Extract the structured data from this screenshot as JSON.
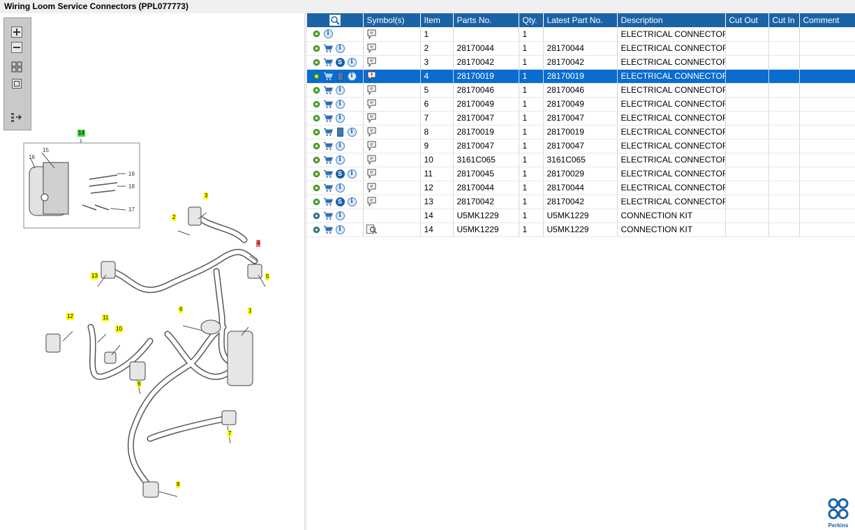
{
  "title": "Wiring Loom Service Connectors (PPL077773)",
  "toolbox": {
    "buttons": [
      {
        "name": "zoom-in-icon"
      },
      {
        "name": "zoom-out-icon"
      },
      {
        "name": "fit-all-icon"
      },
      {
        "name": "fit-window-icon"
      },
      {
        "name": "list-arrow-icon"
      }
    ]
  },
  "diagram": {
    "callouts": [
      {
        "label": "14",
        "color": "#3fd13f"
      },
      {
        "label": "15"
      },
      {
        "label": "16"
      },
      {
        "label": "19"
      },
      {
        "label": "18"
      },
      {
        "label": "17"
      },
      {
        "label": "3",
        "color": "#ffff00"
      },
      {
        "label": "2",
        "color": "#ffff00"
      },
      {
        "label": "4",
        "color": "#ff6b6b"
      },
      {
        "label": "5",
        "color": "#ffff00"
      },
      {
        "label": "13",
        "color": "#ffff00"
      },
      {
        "label": "6",
        "color": "#ffff00"
      },
      {
        "label": "1",
        "color": "#ffff00"
      },
      {
        "label": "12",
        "color": "#ffff00"
      },
      {
        "label": "11",
        "color": "#ffff00"
      },
      {
        "label": "10",
        "color": "#ffff00"
      },
      {
        "label": "9",
        "color": "#ffff00"
      },
      {
        "label": "7",
        "color": "#ffff00"
      },
      {
        "label": "8",
        "color": "#ffff00"
      }
    ]
  },
  "table": {
    "columns": [
      "",
      "Symbol(s)",
      "Item",
      "Parts No.",
      "Qty.",
      "Latest Part No.",
      "Description",
      "Cut Out",
      "Cut In",
      "Comment"
    ],
    "rows": [
      {
        "icons": [
          "gear-icon",
          "info-icon"
        ],
        "symbol": "note",
        "item": "1",
        "part": "",
        "qty": "1",
        "latest": "",
        "desc": "ELECTRICAL CONNECTOR"
      },
      {
        "icons": [
          "gear-icon",
          "cart-icon",
          "info-icon"
        ],
        "symbol": "note",
        "item": "2",
        "part": "28170044",
        "qty": "1",
        "latest": "28170044",
        "desc": "ELECTRICAL CONNECTOR"
      },
      {
        "icons": [
          "gear-icon",
          "cart-icon",
          "s-icon",
          "info-icon"
        ],
        "symbol": "note",
        "item": "3",
        "part": "28170042",
        "qty": "1",
        "latest": "28170042",
        "desc": "ELECTRICAL CONNECTOR"
      },
      {
        "icons": [
          "gear-icon",
          "cart-icon",
          "book-icon",
          "info-icon"
        ],
        "symbol": "note-alert",
        "item": "4",
        "part": "28170019",
        "qty": "1",
        "latest": "28170019",
        "desc": "ELECTRICAL CONNECTOR",
        "selected": true
      },
      {
        "icons": [
          "gear-icon",
          "cart-icon",
          "info-icon"
        ],
        "symbol": "note",
        "item": "5",
        "part": "28170046",
        "qty": "1",
        "latest": "28170046",
        "desc": "ELECTRICAL CONNECTOR"
      },
      {
        "icons": [
          "gear-icon",
          "cart-icon",
          "info-icon"
        ],
        "symbol": "note",
        "item": "6",
        "part": "28170049",
        "qty": "1",
        "latest": "28170049",
        "desc": "ELECTRICAL CONNECTOR"
      },
      {
        "icons": [
          "gear-icon",
          "cart-icon",
          "info-icon"
        ],
        "symbol": "note",
        "item": "7",
        "part": "28170047",
        "qty": "1",
        "latest": "28170047",
        "desc": "ELECTRICAL CONNECTOR"
      },
      {
        "icons": [
          "gear-icon",
          "cart-icon",
          "book-icon",
          "info-icon"
        ],
        "symbol": "note",
        "item": "8",
        "part": "28170019",
        "qty": "1",
        "latest": "28170019",
        "desc": "ELECTRICAL CONNECTOR"
      },
      {
        "icons": [
          "gear-icon",
          "cart-icon",
          "info-icon"
        ],
        "symbol": "note",
        "item": "9",
        "part": "28170047",
        "qty": "1",
        "latest": "28170047",
        "desc": "ELECTRICAL CONNECTOR"
      },
      {
        "icons": [
          "gear-icon",
          "cart-icon",
          "info-icon"
        ],
        "symbol": "note",
        "item": "10",
        "part": "3161C065",
        "qty": "1",
        "latest": "3161C065",
        "desc": "ELECTRICAL CONNECTOR"
      },
      {
        "icons": [
          "gear-icon",
          "cart-icon",
          "s-icon",
          "info-icon"
        ],
        "symbol": "note",
        "item": "11",
        "part": "28170045",
        "qty": "1",
        "latest": "28170029",
        "desc": "ELECTRICAL CONNECTOR"
      },
      {
        "icons": [
          "gear-icon",
          "cart-icon",
          "info-icon"
        ],
        "symbol": "note",
        "item": "12",
        "part": "28170044",
        "qty": "1",
        "latest": "28170044",
        "desc": "ELECTRICAL CONNECTOR"
      },
      {
        "icons": [
          "gear-icon",
          "cart-icon",
          "s-icon",
          "info-icon"
        ],
        "symbol": "note",
        "item": "13",
        "part": "28170042",
        "qty": "1",
        "latest": "28170042",
        "desc": "ELECTRICAL CONNECTOR"
      },
      {
        "icons": [
          "gears-icon",
          "cart-icon",
          "info-icon"
        ],
        "symbol": "",
        "item": "14",
        "part": "U5MK1229",
        "qty": "1",
        "latest": "U5MK1229",
        "desc": "CONNECTION KIT"
      },
      {
        "icons": [
          "gears-icon",
          "cart-icon",
          "info-icon"
        ],
        "symbol": "magnifier",
        "item": "14",
        "part": "U5MK1229",
        "qty": "1",
        "latest": "U5MK1229",
        "desc": "CONNECTION KIT"
      }
    ]
  },
  "brand": {
    "name": "Perkins",
    "color": "#1b63a6"
  }
}
